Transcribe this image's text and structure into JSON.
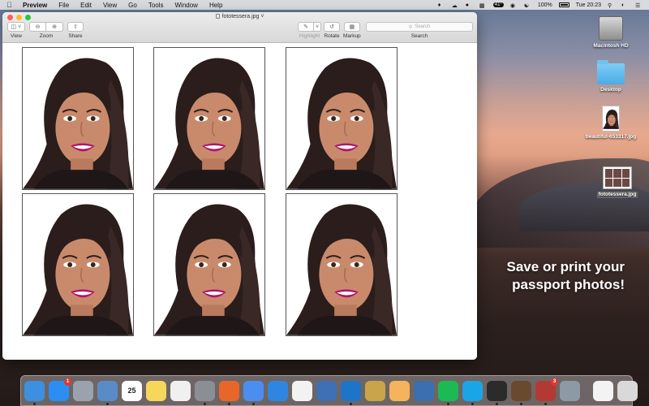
{
  "menubar": {
    "app_name": "Preview",
    "menus": [
      "File",
      "Edit",
      "View",
      "Go",
      "Tools",
      "Window",
      "Help"
    ],
    "temperature": "41°",
    "battery": "100%",
    "clock": "Tue 20:23"
  },
  "window": {
    "title": "fototessera.jpg",
    "toolbar": {
      "view_label": "View",
      "zoom_label": "Zoom",
      "share_label": "Share",
      "highlight_label": "Highlight",
      "rotate_label": "Rotate",
      "markup_label": "Markup",
      "search_placeholder": "Search",
      "search_label": "Search"
    },
    "photo_count": 6
  },
  "desktop": {
    "icons": [
      {
        "label": "Macintosh HD",
        "icon": "hard-drive-icon"
      },
      {
        "label": "Desktop",
        "icon": "folder-icon"
      },
      {
        "label": "beautiful-653317.jpg",
        "icon": "image-file-icon"
      },
      {
        "label": "fototessera.jpg",
        "icon": "image-file-icon"
      }
    ],
    "promo_line1": "Save or print your",
    "promo_line2": "passport photos!"
  },
  "dock": {
    "apps": [
      {
        "name": "Finder",
        "icon": "finder-icon",
        "color": "#3d8fe0"
      },
      {
        "name": "App Store",
        "icon": "app-store-icon",
        "color": "#2b8ef0",
        "badge": "1"
      },
      {
        "name": "Launchpad",
        "icon": "launchpad-icon",
        "color": "#9aa3ad"
      },
      {
        "name": "Preview",
        "icon": "preview-icon",
        "color": "#5b8bc6"
      },
      {
        "name": "Calendar",
        "icon": "calendar-icon",
        "color": "#ffffff",
        "text": "25"
      },
      {
        "name": "Notes",
        "icon": "notes-icon",
        "color": "#f6d75c"
      },
      {
        "name": "Reminders",
        "icon": "reminders-icon",
        "color": "#f0f0f0"
      },
      {
        "name": "System Preferences",
        "icon": "system-preferences-icon",
        "color": "#8a8f96"
      },
      {
        "name": "Firefox",
        "icon": "firefox-icon",
        "color": "#e8662a"
      },
      {
        "name": "Chrome",
        "icon": "chrome-icon",
        "color": "#4c8df0"
      },
      {
        "name": "Safari",
        "icon": "safari-icon",
        "color": "#2f86e0"
      },
      {
        "name": "Photos",
        "icon": "photos-icon",
        "color": "#f2f2f2"
      },
      {
        "name": "Xcode",
        "icon": "xcode-icon",
        "color": "#3f6fb5"
      },
      {
        "name": "Visual Studio Code",
        "icon": "vscode-icon",
        "color": "#1e74c9"
      },
      {
        "name": "Archive Utility",
        "icon": "archive-icon",
        "color": "#c9a44a"
      },
      {
        "name": "Mail",
        "icon": "mail-icon",
        "color": "#f4b35c"
      },
      {
        "name": "VirtualBox",
        "icon": "virtualbox-icon",
        "color": "#3a6fb0"
      },
      {
        "name": "Spotify",
        "icon": "spotify-icon",
        "color": "#1db954"
      },
      {
        "name": "Skype",
        "icon": "skype-icon",
        "color": "#1aa5e6"
      },
      {
        "name": "Terminal",
        "icon": "terminal-icon",
        "color": "#2b2b2b"
      },
      {
        "name": "Calculator",
        "icon": "calculator-icon",
        "color": "#6a4a2f"
      },
      {
        "name": "Photo Booth",
        "icon": "photo-booth-icon",
        "color": "#b33a34",
        "badge": "3"
      },
      {
        "name": "Image Capture",
        "icon": "image-capture-icon",
        "color": "#8d9aa6"
      }
    ],
    "stack": {
      "name": "Documents",
      "icon": "document-stack-icon",
      "color": "#f3f3f3"
    },
    "trash": {
      "name": "Trash",
      "icon": "trash-icon",
      "color": "#d9d9d9"
    }
  }
}
